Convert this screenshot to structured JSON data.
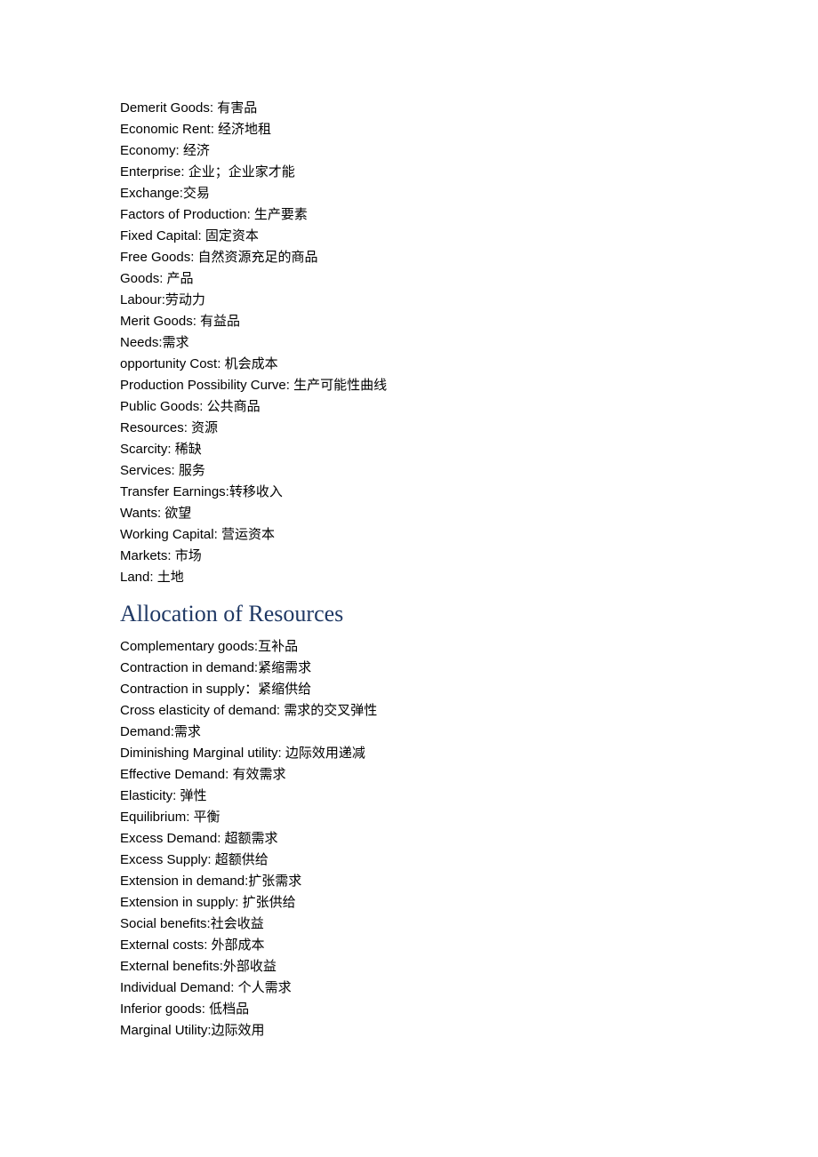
{
  "sections": [
    {
      "heading": null,
      "terms": [
        {
          "en": "Demerit Goods: ",
          "zh": "有害品"
        },
        {
          "en": "Economic Rent: ",
          "zh": "经济地租"
        },
        {
          "en": "Economy: ",
          "zh": "经济"
        },
        {
          "en": "Enterprise: ",
          "zh": "企业；企业家才能"
        },
        {
          "en": "Exchange:",
          "zh": "交易"
        },
        {
          "en": "Factors of Production: ",
          "zh": "生产要素"
        },
        {
          "en": "Fixed Capital: ",
          "zh": "固定资本"
        },
        {
          "en": "Free Goods: ",
          "zh": "自然资源充足的商品"
        },
        {
          "en": "Goods: ",
          "zh": "产品"
        },
        {
          "en": "Labour:",
          "zh": "劳动力"
        },
        {
          "en": "Merit Goods: ",
          "zh": "有益品"
        },
        {
          "en": "Needs:",
          "zh": "需求"
        },
        {
          "en": "opportunity Cost: ",
          "zh": "机会成本"
        },
        {
          "en": "Production Possibility Curve: ",
          "zh": "生产可能性曲线"
        },
        {
          "en": "Public Goods: ",
          "zh": "公共商品"
        },
        {
          "en": "Resources: ",
          "zh": "资源"
        },
        {
          "en": "Scarcity: ",
          "zh": "稀缺"
        },
        {
          "en": "Services: ",
          "zh": "服务"
        },
        {
          "en": "Transfer Earnings:",
          "zh": "转移收入"
        },
        {
          "en": "Wants: ",
          "zh": "欲望"
        },
        {
          "en": "Working Capital: ",
          "zh": "营运资本"
        },
        {
          "en": "Markets: ",
          "zh": "市场"
        },
        {
          "en": "Land: ",
          "zh": "土地"
        }
      ]
    },
    {
      "heading": "Allocation of Resources",
      "terms": [
        {
          "en": "Complementary goods:",
          "zh": "互补品"
        },
        {
          "en": "Contraction in demand:",
          "zh": "紧缩需求"
        },
        {
          "en": "Contraction in supply：",
          "zh": "紧缩供给"
        },
        {
          "en": "Cross elasticity of demand: ",
          "zh": "需求的交叉弹性"
        },
        {
          "en": "Demand:",
          "zh": "需求"
        },
        {
          "en": "Diminishing Marginal utility: ",
          "zh": "边际效用递减"
        },
        {
          "en": "Effective Demand: ",
          "zh": "有效需求"
        },
        {
          "en": "Elasticity: ",
          "zh": "弹性"
        },
        {
          "en": "Equilibrium: ",
          "zh": "平衡"
        },
        {
          "en": "Excess Demand: ",
          "zh": "超额需求"
        },
        {
          "en": "Excess Supply: ",
          "zh": "超额供给"
        },
        {
          "en": "Extension in demand:",
          "zh": "扩张需求"
        },
        {
          "en": "Extension in supply: ",
          "zh": "扩张供给"
        },
        {
          "en": "Social benefits:",
          "zh": "社会收益"
        },
        {
          "en": "External costs: ",
          "zh": "外部成本"
        },
        {
          "en": "External benefits:",
          "zh": "外部收益"
        },
        {
          "en": "Individual Demand: ",
          "zh": "个人需求"
        },
        {
          "en": "Inferior goods: ",
          "zh": "低档品"
        },
        {
          "en": "Marginal Utility:",
          "zh": "边际效用"
        }
      ]
    }
  ]
}
